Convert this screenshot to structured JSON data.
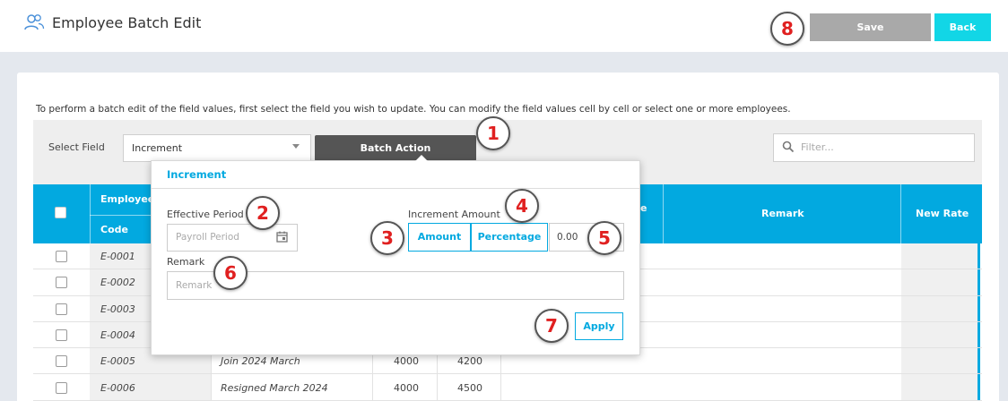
{
  "header": {
    "title": "Employee Batch Edit",
    "save_label": "Save",
    "back_label": "Back"
  },
  "instruction": "To perform a batch edit of the field values, first select the field you wish to update. You can modify the field values cell by cell or select one or more employees.",
  "toolbar": {
    "select_label": "Select Field",
    "select_value": "Increment",
    "batch_action_label": "Batch Action",
    "filter_placeholder": "Filter..."
  },
  "table": {
    "headers": {
      "employee": "Employee",
      "code": "Code",
      "rate_partial": "e",
      "remark": "Remark",
      "new_rate": "New Rate"
    },
    "rows": [
      {
        "code": "E-0001",
        "remark": "",
        "old": "",
        "new": ""
      },
      {
        "code": "E-0002",
        "remark": "",
        "old": "",
        "new": ""
      },
      {
        "code": "E-0003",
        "remark": "",
        "old": "",
        "new": ""
      },
      {
        "code": "E-0004",
        "remark": "",
        "old": "",
        "new": ""
      },
      {
        "code": "E-0005",
        "remark": "Join 2024 March",
        "old": "4000",
        "new": "4200"
      },
      {
        "code": "E-0006",
        "remark": "Resigned March 2024",
        "old": "4000",
        "new": "4500"
      }
    ]
  },
  "popup": {
    "title": "Increment",
    "effective_period_label": "Effective Period",
    "period_placeholder": "Payroll Period",
    "increment_amount_label": "Increment Amount",
    "amount_label": "Amount",
    "percentage_label": "Percentage",
    "amount_value": "0.00",
    "remark_label": "Remark",
    "remark_placeholder": "Remark",
    "apply_label": "Apply"
  },
  "markers": [
    "1",
    "2",
    "3",
    "4",
    "5",
    "6",
    "7",
    "8"
  ],
  "colors": {
    "accent": "#02a9e0",
    "back_button": "#12d6e6",
    "save_button": "#a9a9a9",
    "batch_button": "#555555",
    "marker_text": "#e02020"
  }
}
